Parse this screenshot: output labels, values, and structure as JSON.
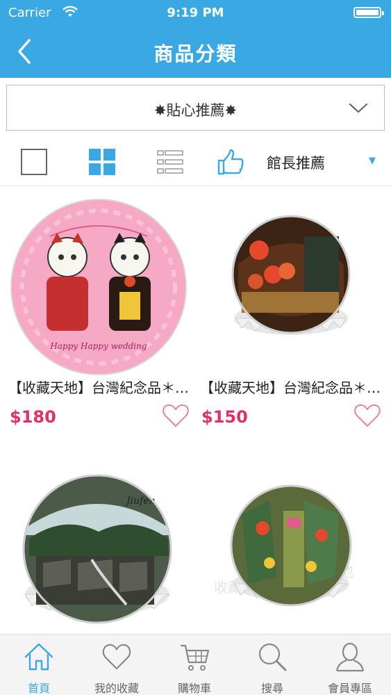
{
  "status_bar": {
    "carrier": "Carrier",
    "time": "9:19 PM"
  },
  "nav": {
    "title": "商品分類",
    "back_icon": "chevron-left-icon"
  },
  "category_dropdown": {
    "selected": "✸貼心推薦✸",
    "icon": "chevron-down-icon"
  },
  "toolbar": {
    "view_modes": [
      "single-view-icon",
      "grid-view-icon",
      "list-view-icon"
    ],
    "active_view": "grid",
    "sort_icon": "thumbs-up-icon",
    "sort_label": "館長推薦",
    "sort_arrow": "▼"
  },
  "products": [
    {
      "name": "【收藏天地】台灣紀念品＊神奇的陶瓷吸水杯墊-...",
      "price": "$180",
      "image": "cat-wedding-coaster"
    },
    {
      "name": "【收藏天地】台灣紀念品＊開瓶器冰箱貼-九份街...",
      "price": "$150",
      "image": "jiufen-lantern-bottle-opener"
    },
    {
      "name": "",
      "price": "",
      "image": "jiufen-town-bottle-opener"
    },
    {
      "name": "",
      "price": "",
      "image": "dihua-street-bottle-opener"
    }
  ],
  "tabs": [
    {
      "label": "首頁",
      "icon": "home-icon",
      "active": true
    },
    {
      "label": "我的收藏",
      "icon": "heart-icon",
      "active": false
    },
    {
      "label": "購物車",
      "icon": "cart-icon",
      "active": false
    },
    {
      "label": "搜尋",
      "icon": "search-icon",
      "active": false
    },
    {
      "label": "會員專區",
      "icon": "user-icon",
      "active": false
    }
  ],
  "colors": {
    "accent": "#3aa9e3",
    "price": "#e0306b",
    "heart": "#e8848f"
  }
}
